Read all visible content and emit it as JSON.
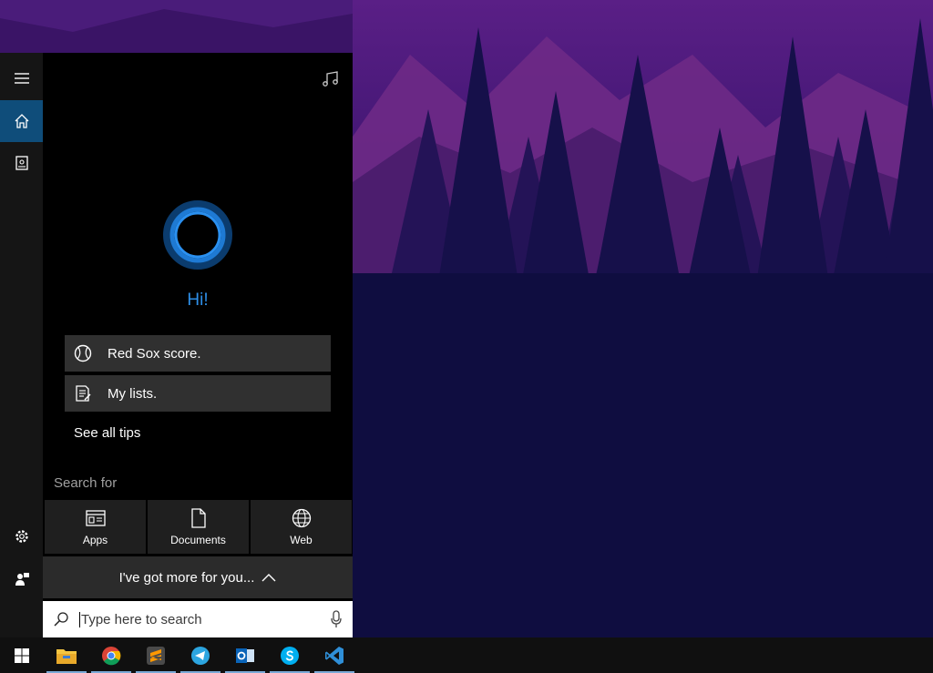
{
  "cortana": {
    "greeting": "Hi!",
    "tips": [
      {
        "label": "Red Sox score.",
        "icon": "baseball-icon"
      },
      {
        "label": "My lists.",
        "icon": "notepad-icon"
      }
    ],
    "see_all_tips": "See all tips",
    "search_for_label": "Search for",
    "categories": [
      {
        "label": "Apps",
        "icon": "apps-icon"
      },
      {
        "label": "Documents",
        "icon": "document-icon"
      },
      {
        "label": "Web",
        "icon": "globe-icon"
      }
    ],
    "more_label": "I've got more for you...",
    "search": {
      "placeholder": "Type here to search",
      "value": ""
    }
  },
  "rail": [
    "hamburger-menu-icon",
    "home-icon",
    "notebook-icon",
    "settings-icon",
    "feedback-icon"
  ],
  "taskbar": [
    "windows-start-icon",
    "file-explorer-icon",
    "chrome-icon",
    "sublime-text-icon",
    "telegram-icon",
    "outlook-icon",
    "skype-icon",
    "vscode-icon"
  ],
  "colors": {
    "accent": "#2e8fe8",
    "rail_active": "#0f4d7a",
    "tip_bg": "#303030"
  }
}
